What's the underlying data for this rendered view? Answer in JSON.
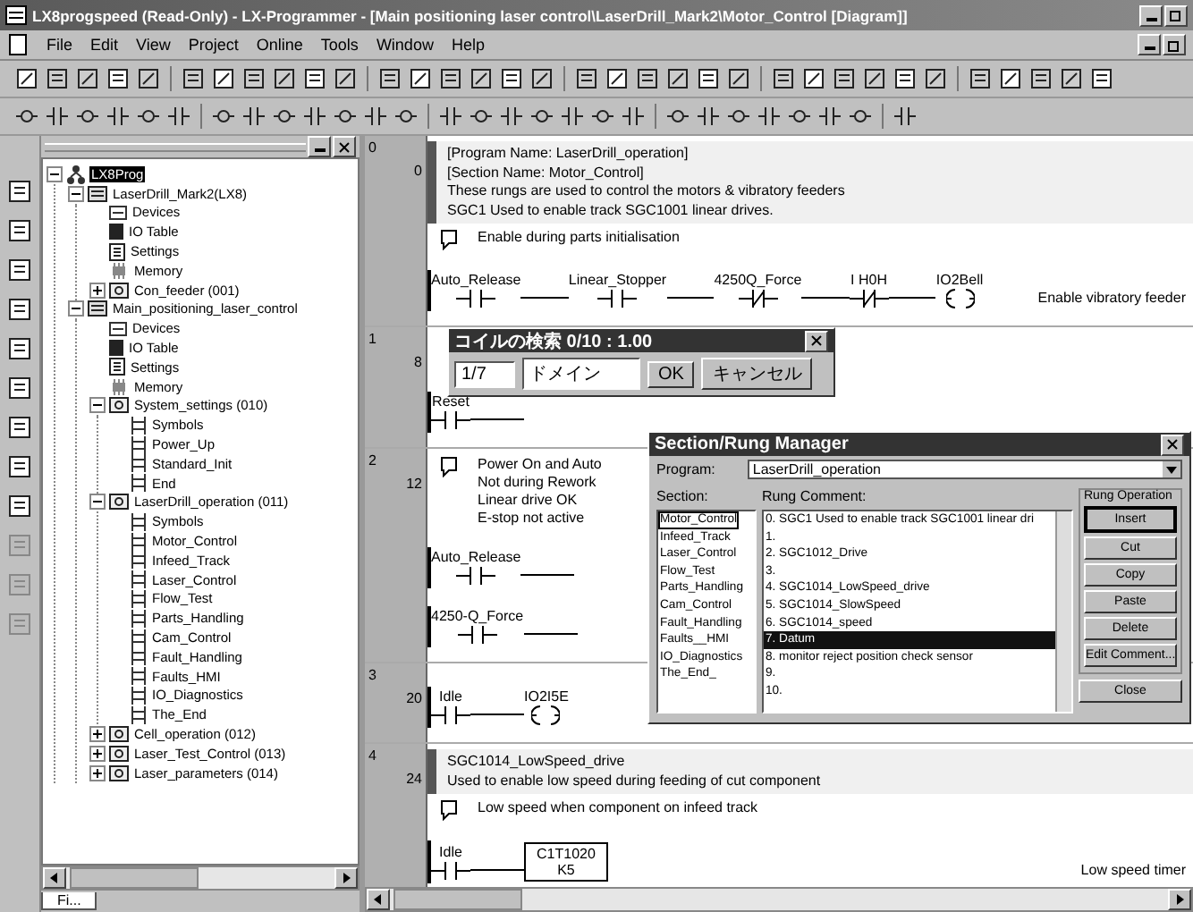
{
  "window": {
    "title": "LX8progspeed (Read-Only) - LX-Programmer - [Main positioning laser control\\LaserDrill_Mark2\\Motor_Control [Diagram]]"
  },
  "menu": [
    "File",
    "Edit",
    "View",
    "Project",
    "Online",
    "Tools",
    "Window",
    "Help"
  ],
  "tree": {
    "items": [
      {
        "label": "LX8Prog",
        "kind": "root",
        "expanded": true,
        "selected": true,
        "children": [
          {
            "label": "LaserDrill_Mark2(LX8)",
            "kind": "plc",
            "expanded": true,
            "selected": false,
            "children": [
              {
                "label": "Devices",
                "kind": "devices",
                "selected": false
              },
              {
                "label": "IO Table",
                "kind": "io",
                "selected": false
              },
              {
                "label": "Settings",
                "kind": "settings",
                "selected": false
              },
              {
                "label": "Memory",
                "kind": "memory",
                "selected": false
              },
              {
                "label": "Con_feeder (001)",
                "kind": "program",
                "expanded": false,
                "selected": false
              }
            ]
          },
          {
            "label": "Main_positioning_laser_control",
            "kind": "plc",
            "expanded": true,
            "selected": false,
            "children": [
              {
                "label": "Devices",
                "kind": "devices",
                "selected": false
              },
              {
                "label": "IO Table",
                "kind": "io",
                "selected": false
              },
              {
                "label": "Settings",
                "kind": "settings",
                "selected": false
              },
              {
                "label": "Memory",
                "kind": "memory",
                "selected": false
              },
              {
                "label": "System_settings (010)",
                "kind": "program",
                "expanded": true,
                "selected": false,
                "children": [
                  {
                    "label": "Symbols",
                    "kind": "section",
                    "selected": false
                  },
                  {
                    "label": "Power_Up",
                    "kind": "section",
                    "selected": false
                  },
                  {
                    "label": "Standard_Init",
                    "kind": "section",
                    "selected": false
                  },
                  {
                    "label": "End",
                    "kind": "section",
                    "selected": false
                  }
                ]
              },
              {
                "label": "LaserDrill_operation (011)",
                "kind": "program",
                "expanded": true,
                "selected": false,
                "children": [
                  {
                    "label": "Symbols",
                    "kind": "section",
                    "selected": false
                  },
                  {
                    "label": "Motor_Control",
                    "kind": "section",
                    "selected": false
                  },
                  {
                    "label": "Infeed_Track",
                    "kind": "section",
                    "selected": false
                  },
                  {
                    "label": "Laser_Control",
                    "kind": "section",
                    "selected": false
                  },
                  {
                    "label": "Flow_Test",
                    "kind": "section",
                    "selected": false
                  },
                  {
                    "label": "Parts_Handling",
                    "kind": "section",
                    "selected": false
                  },
                  {
                    "label": "Cam_Control",
                    "kind": "section",
                    "selected": false
                  },
                  {
                    "label": "Fault_Handling",
                    "kind": "section",
                    "selected": false
                  },
                  {
                    "label": "Faults_HMI",
                    "kind": "section",
                    "selected": false
                  },
                  {
                    "label": "IO_Diagnostics",
                    "kind": "section",
                    "selected": false
                  },
                  {
                    "label": "The_End",
                    "kind": "section",
                    "selected": false
                  }
                ]
              },
              {
                "label": "Cell_operation (012)",
                "kind": "program",
                "expanded": false,
                "selected": false
              },
              {
                "label": "Laser_Test_Control (013)",
                "kind": "program",
                "expanded": false,
                "selected": false
              },
              {
                "label": "Laser_parameters (014)",
                "kind": "program",
                "expanded": false,
                "selected": false
              }
            ]
          }
        ]
      }
    ],
    "tab": "Fi..."
  },
  "ladder": {
    "rungs": [
      {
        "number": "0",
        "step": "0",
        "comments": [
          "[Program Name: LaserDrill_operation]",
          "[Section Name: Motor_Control]",
          "These rungs are used to control the motors & vibratory feeders",
          "SGC1 Used to enable track SGC1001 linear drives."
        ],
        "note": "Enable during parts initialisation",
        "rows": [
          {
            "contacts": [
              {
                "kind": "no",
                "label": "Auto_Release"
              },
              {
                "kind": "no",
                "label": "Linear_Stopper"
              },
              {
                "kind": "nc",
                "label": "4250Q_Force"
              },
              {
                "kind": "nc",
                "label": "I H0H"
              }
            ],
            "coil": {
              "label": "IO2Bell",
              "text": "Enable vibratory feeder"
            }
          }
        ]
      },
      {
        "number": "1",
        "step": "8",
        "rows": [
          {
            "contacts": [
              {
                "kind": "no",
                "label": "Reset"
              }
            ]
          }
        ]
      },
      {
        "number": "2",
        "step": "12",
        "note": "Power On and Auto\nNot during Rework\nLinear drive OK\nE-stop not active",
        "rows": [
          {
            "contacts": [
              {
                "kind": "no",
                "label": "Auto_Release"
              }
            ]
          },
          {
            "contacts": [
              {
                "kind": "no",
                "label": "4250-Q_Force"
              }
            ]
          }
        ]
      },
      {
        "number": "3",
        "step": "20",
        "rows": [
          {
            "contacts": [
              {
                "kind": "no",
                "label": "Idle"
              }
            ],
            "coil": {
              "label": "IO2I5E"
            }
          }
        ]
      },
      {
        "number": "4",
        "step": "24",
        "comments": [
          "SGC1014_LowSpeed_drive",
          "Used to enable low speed during feeding of cut component"
        ],
        "note": "Low speed when component on infeed track",
        "rows": [
          {
            "contacts": [
              {
                "kind": "no",
                "label": "Idle"
              }
            ],
            "coil": {
              "kind": "box",
              "label": "C1T1020",
              "sub": "K5",
              "text": "Low speed timer"
            }
          }
        ]
      }
    ]
  },
  "jump_dialog": {
    "title": "コイルの検索 0/10 : 1.00",
    "count": "1/7",
    "value": "ドメイン",
    "buttons": [
      "OK",
      "キャンセル"
    ]
  },
  "rung_manager": {
    "title": "Section/Rung Manager",
    "program_label": "Program:",
    "program": "LaserDrill_operation",
    "section_label": "Section:",
    "comment_label": "Rung Comment:",
    "operation_label": "Rung Operation",
    "sections": [
      {
        "label": "Motor_Control",
        "selected": true
      },
      {
        "label": "Infeed_Track",
        "selected": false
      },
      {
        "label": "Laser_Control",
        "selected": false
      },
      {
        "label": "Flow_Test",
        "selected": false
      },
      {
        "label": "Parts_Handling",
        "selected": false
      },
      {
        "label": "Cam_Control",
        "selected": false
      },
      {
        "label": "Fault_Handling",
        "selected": false
      },
      {
        "label": "Faults__HMI",
        "selected": false
      },
      {
        "label": "IO_Diagnostics",
        "selected": false
      },
      {
        "label": "The_End_",
        "selected": false
      }
    ],
    "comments": [
      {
        "label": "0. SGC1 Used to enable track SGC1001 linear dri",
        "selected": false
      },
      {
        "label": "1.",
        "selected": false
      },
      {
        "label": "2. SGC1012_Drive",
        "selected": false
      },
      {
        "label": "3.",
        "selected": false
      },
      {
        "label": "4. SGC1014_LowSpeed_drive",
        "selected": false
      },
      {
        "label": "5. SGC1014_SlowSpeed",
        "selected": false
      },
      {
        "label": "6. SGC1014_speed",
        "selected": false
      },
      {
        "label": "7. Datum",
        "selected": true
      },
      {
        "label": "8. monitor reject position check sensor",
        "selected": false
      },
      {
        "label": "9.",
        "selected": false
      },
      {
        "label": "10.",
        "selected": false
      }
    ],
    "buttons": [
      {
        "label": "Insert",
        "default": true
      },
      {
        "label": "Cut",
        "default": false
      },
      {
        "label": "Copy",
        "default": false
      },
      {
        "label": "Paste",
        "default": false
      },
      {
        "label": "Delete",
        "default": false
      },
      {
        "label": "Edit Comment...",
        "default": false
      }
    ],
    "close": "Close"
  }
}
